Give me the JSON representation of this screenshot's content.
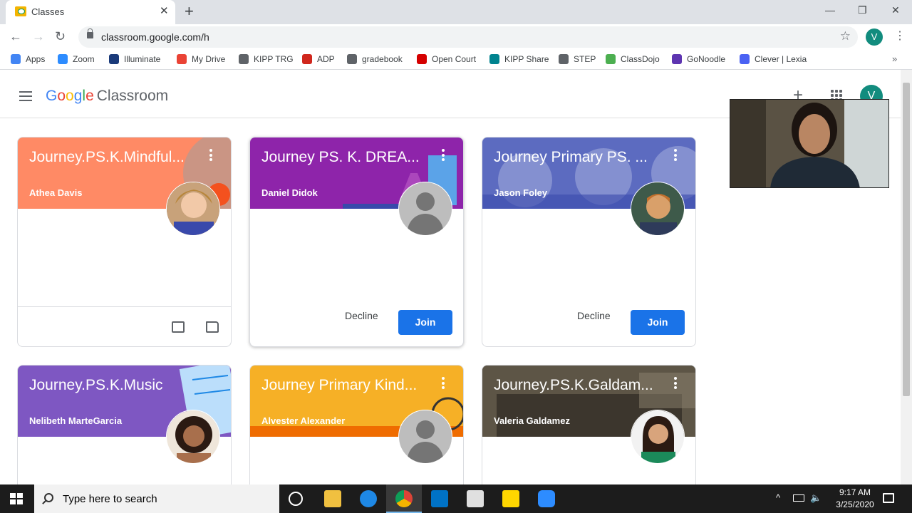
{
  "browser": {
    "tab_title": "Classes",
    "url": "classroom.google.com/h",
    "profile_initial": "V",
    "bookmarks": [
      {
        "label": "Apps",
        "color": "#4285f4"
      },
      {
        "label": "Zoom",
        "color": "#2d8cff"
      },
      {
        "label": "Illuminate",
        "color": "#1a3a7a"
      },
      {
        "label": "My Drive",
        "color": "#ea4335"
      },
      {
        "label": "KIPP TRG",
        "color": "#5f6368"
      },
      {
        "label": "ADP",
        "color": "#d0271d"
      },
      {
        "label": "gradebook",
        "color": "#5f6368"
      },
      {
        "label": "Open Court",
        "color": "#d50000"
      },
      {
        "label": "KIPP Share",
        "color": "#00838f"
      },
      {
        "label": "STEP",
        "color": "#5f6368"
      },
      {
        "label": "ClassDojo",
        "color": "#4caf50"
      },
      {
        "label": "GoNoodle",
        "color": "#5e35b1"
      },
      {
        "label": "Clever | Lexia",
        "color": "#4a62f3"
      }
    ]
  },
  "app": {
    "logo_word": [
      "G",
      "o",
      "o",
      "g",
      "l",
      "e"
    ],
    "logo_product": "Classroom",
    "account_initial": "V"
  },
  "cards": [
    {
      "name": "Journey.PS.K.Mindful...",
      "teacher": "Athea Davis",
      "color": "#ff8a65",
      "avatar": "photo",
      "state": "enrolled"
    },
    {
      "name": "Journey PS. K. DREA...",
      "teacher": "Daniel Didok",
      "color": "#8e24aa",
      "avatar": "default",
      "state": "invited"
    },
    {
      "name": "Journey Primary PS. ...",
      "teacher": "Jason Foley",
      "color": "#3f51b5",
      "avatar": "photo",
      "state": "invited"
    },
    {
      "name": "Journey.PS.K.Music",
      "teacher": "Nelibeth MarteGarcia",
      "color": "#7e57c2",
      "avatar": "photo",
      "state": "enrolled"
    },
    {
      "name": "Journey Primary Kind...",
      "teacher": "Alvester Alexander",
      "color": "#f6a623",
      "avatar": "default",
      "state": "enrolled"
    },
    {
      "name": "Journey.PS.K.Galdam...",
      "teacher": "Valeria Galdamez",
      "color": "#3e3a2e",
      "avatar": "photo",
      "state": "enrolled"
    }
  ],
  "actions": {
    "decline": "Decline",
    "join": "Join"
  },
  "help_glyph": "?",
  "taskbar": {
    "search_placeholder": "Type here to search",
    "time": "9:17 AM",
    "date": "3/25/2020"
  }
}
